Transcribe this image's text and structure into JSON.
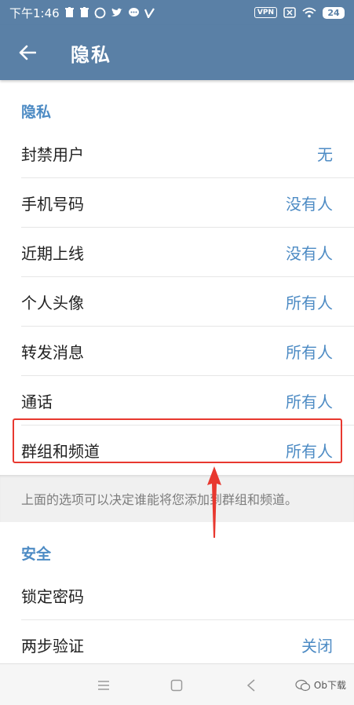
{
  "status_bar": {
    "time": "下午1:46",
    "vpn_label": "VPN",
    "battery": "24",
    "icons": [
      "trash-icon",
      "trash-icon",
      "whatsapp-icon",
      "twitter-icon",
      "message-icon",
      "v-icon",
      "vpn-icon",
      "sim-off-icon",
      "wifi-icon",
      "battery-icon"
    ]
  },
  "app_bar": {
    "title": "隐私",
    "back_icon": "arrow-left-icon"
  },
  "privacy_section": {
    "header": "隐私",
    "items": [
      {
        "label": "封禁用户",
        "value": "无"
      },
      {
        "label": "手机号码",
        "value": "没有人"
      },
      {
        "label": "近期上线",
        "value": "没有人"
      },
      {
        "label": "个人头像",
        "value": "所有人"
      },
      {
        "label": "转发消息",
        "value": "所有人"
      },
      {
        "label": "通话",
        "value": "所有人"
      },
      {
        "label": "群组和频道",
        "value": "所有人"
      }
    ],
    "info": "上面的选项可以决定谁能将您添加到群组和频道。"
  },
  "security_section": {
    "header": "安全",
    "items": [
      {
        "label": "锁定密码",
        "value": ""
      },
      {
        "label": "两步验证",
        "value": "关闭"
      }
    ]
  },
  "nav_bar": {
    "icons": [
      "menu-icon",
      "home-square-icon",
      "back-chevron-icon"
    ],
    "watermark": "Ob下载"
  },
  "colors": {
    "header": "#5a80a6",
    "accent": "#4d8bc4",
    "highlight": "#e8382f"
  }
}
